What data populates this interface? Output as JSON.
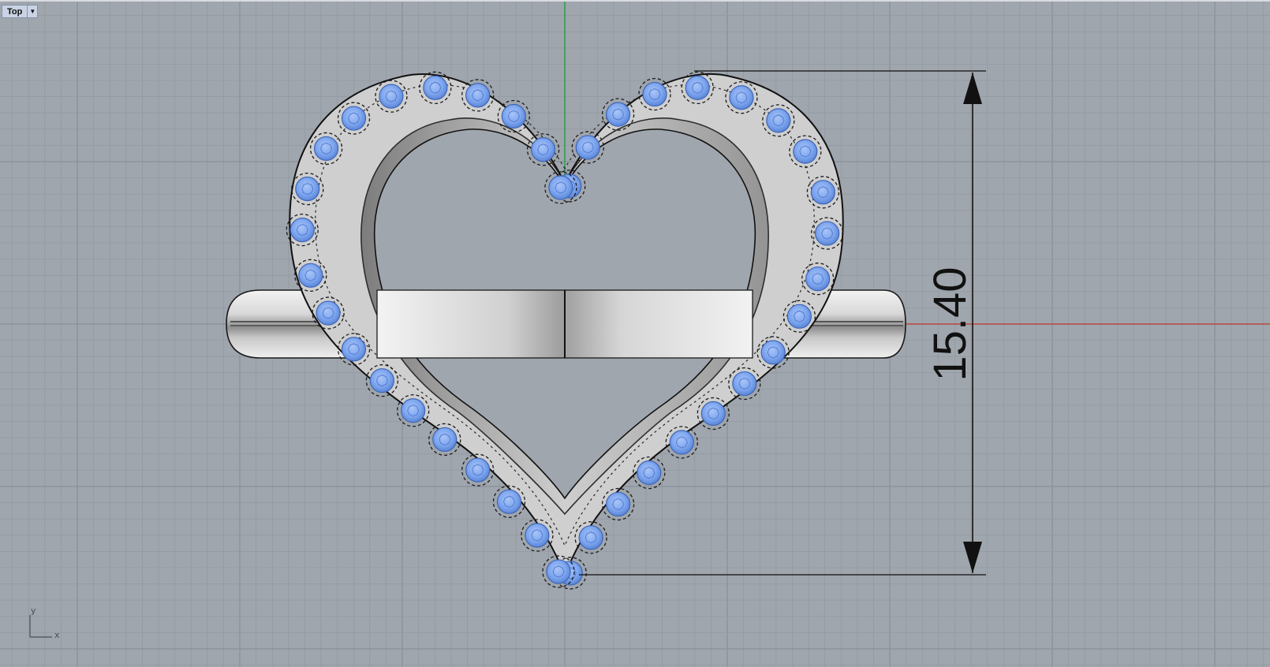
{
  "viewport": {
    "name": "Top",
    "menu_icon": "dropdown-arrow-icon"
  },
  "dimension": {
    "value": "15.40"
  },
  "axes": {
    "x_label": "x",
    "y_label": "y",
    "x_axis_color": "#c0392b",
    "y_axis_color": "#17a13a"
  },
  "colors": {
    "background": "#a0a6ad",
    "grid_minor": "#9399a0",
    "grid_major": "#8a9097",
    "gem": "#7ea6ef",
    "metal": "#d4d4d4"
  },
  "model": {
    "gem_count": 40
  }
}
